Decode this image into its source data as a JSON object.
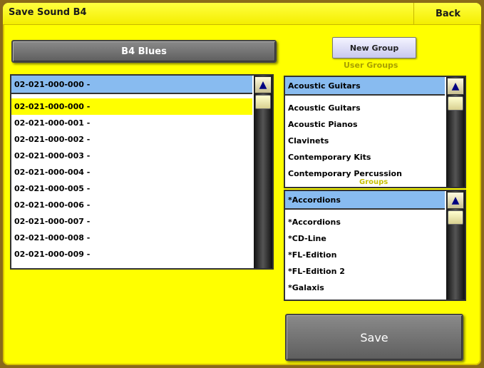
{
  "window": {
    "title": "Save Sound B4",
    "back_label": "Back"
  },
  "sound_name": "B4 Blues",
  "new_group_label": "New Group",
  "user_groups_label": "User Groups",
  "groups_label": "Groups",
  "save_label": "Save",
  "sound_list": {
    "selected": "02-021-000-000 -",
    "items": [
      "02-021-000-000 -",
      "02-021-000-001 -",
      "02-021-000-002 -",
      "02-021-000-003 -",
      "02-021-000-004 -",
      "02-021-000-005 -",
      "02-021-000-006 -",
      "02-021-000-007 -",
      "02-021-000-008 -",
      "02-021-000-009 -"
    ]
  },
  "user_groups": {
    "selected": "Acoustic Guitars",
    "items": [
      "Acoustic Guitars",
      "Acoustic Pianos",
      "Clavinets",
      "Contemporary Kits",
      "Contemporary Percussion"
    ]
  },
  "groups": {
    "selected": "*Accordions",
    "items": [
      "*Accordions",
      "*CD-Line",
      "*FL-Edition",
      "*FL-Edition 2",
      "*Galaxis"
    ]
  },
  "icons": {
    "scroll_up": "scroll-up-arrow-icon"
  },
  "colors": {
    "background": "#ffff00",
    "header_highlight": "#88bbf0",
    "selected_row": "#ffff00"
  }
}
